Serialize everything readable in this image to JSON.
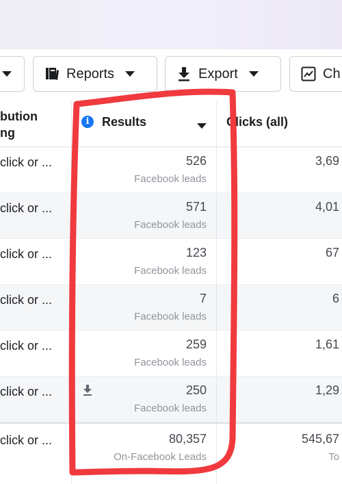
{
  "toolbar": {
    "reports_label": "Reports",
    "export_label": "Export",
    "chart_label": "Ch"
  },
  "table": {
    "headers": {
      "attribution": [
        "bution",
        "ng"
      ],
      "results": "Results",
      "clicks": "Clicks (all)"
    },
    "rows": [
      {
        "attribution": "click or ...",
        "result": "526",
        "result_type": "Facebook leads",
        "clicks": "3,69"
      },
      {
        "attribution": "click or ...",
        "result": "571",
        "result_type": "Facebook leads",
        "clicks": "4,01"
      },
      {
        "attribution": "click or ...",
        "result": "123",
        "result_type": "Facebook leads",
        "clicks": "67"
      },
      {
        "attribution": "click or ...",
        "result": "7",
        "result_type": "Facebook leads",
        "clicks": "6"
      },
      {
        "attribution": "click or ...",
        "result": "259",
        "result_type": "Facebook leads",
        "clicks": "1,61"
      },
      {
        "attribution": "click or ...",
        "result": "250",
        "result_type": "Facebook leads",
        "clicks": "1,29"
      }
    ],
    "total": {
      "attribution": "click or ...",
      "result": "80,357",
      "result_type": "On-Facebook Leads",
      "clicks": "545,67",
      "clicks_sub": "To"
    }
  },
  "colors": {
    "annotation": "#f03a3e",
    "info": "#1877f2",
    "alt_row": "#f5f6f7"
  }
}
